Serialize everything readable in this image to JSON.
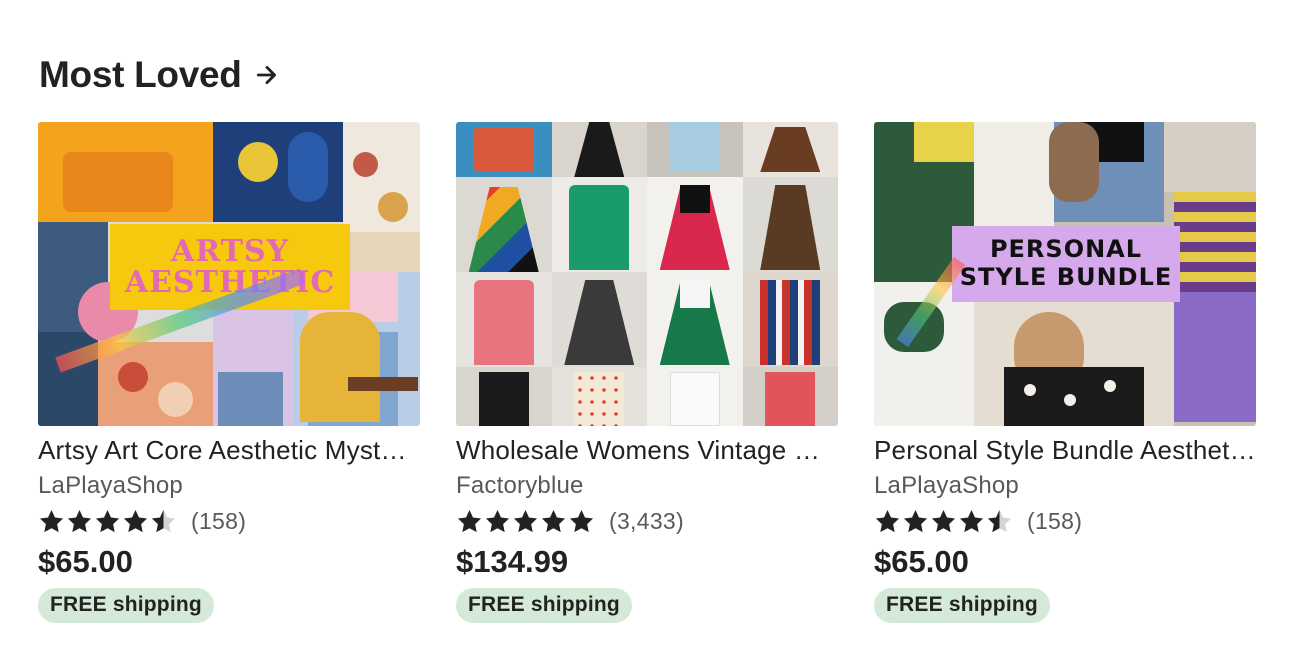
{
  "section": {
    "title": "Most Loved",
    "arrow_icon": "arrow-right-icon"
  },
  "listings": [
    {
      "image_alt": "Artsy art core aesthetic collage",
      "image_text": [
        "ARTSY",
        "AESTHETIC"
      ],
      "title": "Artsy Art Core Aesthetic Mystery Bundle",
      "shop": "LaPlayaShop",
      "rating": 4.5,
      "reviews": "(158)",
      "price": "$65.00",
      "badge": "FREE shipping"
    },
    {
      "image_alt": "Grid of vintage women's dresses",
      "image_text": [],
      "title": "Wholesale Womens Vintage Dresses Bundle",
      "shop": "Factoryblue",
      "rating": 5,
      "reviews": "(3,433)",
      "price": "$134.99",
      "badge": "FREE shipping"
    },
    {
      "image_alt": "Personal style bundle collage",
      "image_text": [
        "PERSONAL",
        "STYLE BUNDLE"
      ],
      "title": "Personal Style Bundle Aesthetic Mystery Box",
      "shop": "LaPlayaShop",
      "rating": 4.5,
      "reviews": "(158)",
      "price": "$65.00",
      "badge": "FREE shipping"
    }
  ],
  "colors": {
    "badge_bg": "#d4e9d7",
    "text": "#222222",
    "muted": "#595959"
  }
}
